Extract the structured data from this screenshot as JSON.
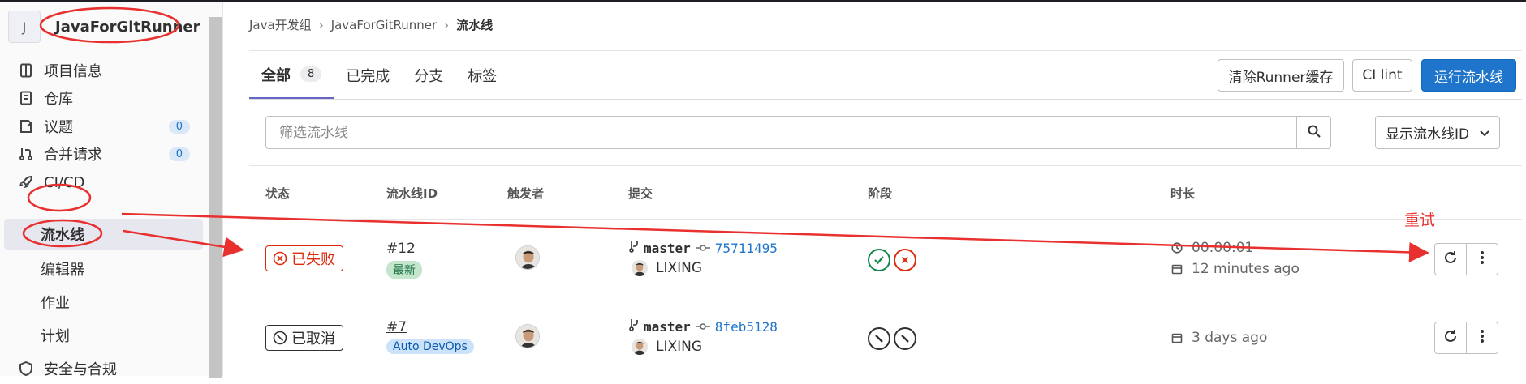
{
  "sidebar": {
    "project_initial": "J",
    "project_name": "JavaForGitRunner",
    "items": [
      {
        "label": "项目信息",
        "icon": "project-icon"
      },
      {
        "label": "仓库",
        "icon": "repository-icon"
      },
      {
        "label": "议题",
        "icon": "issues-icon",
        "count": "0"
      },
      {
        "label": "合并请求",
        "icon": "merge-request-icon",
        "count": "0"
      },
      {
        "label": "CI/CD",
        "icon": "rocket-icon"
      },
      {
        "label": "流水线",
        "active": true
      },
      {
        "label": "编辑器"
      },
      {
        "label": "作业"
      },
      {
        "label": "计划"
      },
      {
        "label": "安全与合规",
        "icon": "shield-icon"
      }
    ]
  },
  "breadcrumb": [
    "Java开发组",
    "JavaForGitRunner",
    "流水线"
  ],
  "tabs": [
    {
      "label": "全部",
      "count": "8",
      "active": true
    },
    {
      "label": "已完成"
    },
    {
      "label": "分支"
    },
    {
      "label": "标签"
    }
  ],
  "buttons": {
    "clear_cache": "清除Runner缓存",
    "ci_lint": "CI lint",
    "run_pipeline": "运行流水线"
  },
  "filter": {
    "placeholder": "筛选流水线",
    "dropdown": "显示流水线ID"
  },
  "table": {
    "headers": [
      "状态",
      "流水线ID",
      "触发者",
      "提交",
      "阶段",
      "时长"
    ],
    "rows": [
      {
        "status": "已失败",
        "status_type": "failed",
        "pipeline_id": "#12",
        "label": "最新",
        "branch": "master",
        "sha": "75711495",
        "author": "LIXING",
        "stages": [
          "success",
          "failed"
        ],
        "duration": "00:00:01",
        "finished": "12 minutes ago"
      },
      {
        "status": "已取消",
        "status_type": "canceled",
        "pipeline_id": "#7",
        "label": "Auto DevOps",
        "branch": "master",
        "sha": "8feb5128",
        "author": "LIXING",
        "stages": [
          "canceled",
          "canceled"
        ],
        "finished": "3 days ago"
      }
    ]
  },
  "annotation": {
    "text": "重试",
    "color": "#e8312f"
  },
  "colors": {
    "accent": "#1f75cb",
    "failed": "#dd2b0e",
    "success": "#108548",
    "tab_underline": "#6666c4"
  }
}
